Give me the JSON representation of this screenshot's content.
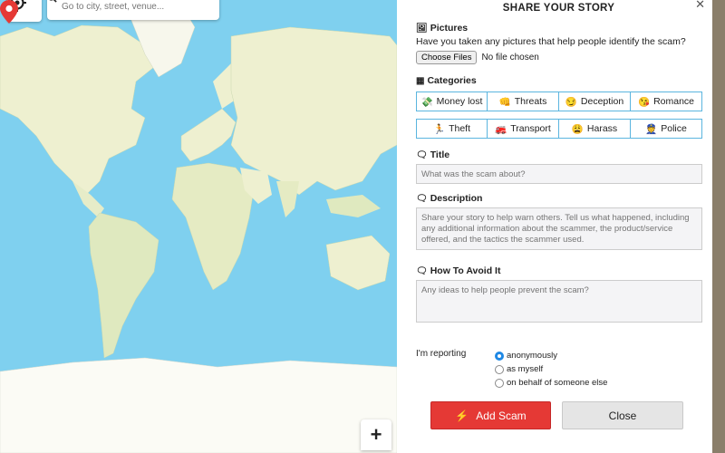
{
  "map": {
    "search_placeholder": "Go to city, street, venue...",
    "zoom_in_label": "+"
  },
  "panel": {
    "title": "SHARE YOUR STORY",
    "close_label": "✕",
    "pictures": {
      "heading": "Pictures",
      "question": "Have you taken any pictures that help people identify the scam?",
      "choose_files": "Choose Files",
      "no_file": "No file chosen"
    },
    "categories": {
      "heading": "Categories",
      "row1": [
        {
          "emoji": "💸",
          "label": "Money lost"
        },
        {
          "emoji": "👊",
          "label": "Threats"
        },
        {
          "emoji": "😏",
          "label": "Deception"
        },
        {
          "emoji": "😘",
          "label": "Romance"
        }
      ],
      "row2": [
        {
          "emoji": "🏃",
          "label": "Theft"
        },
        {
          "emoji": "🚒",
          "label": "Transport"
        },
        {
          "emoji": "😩",
          "label": "Harass"
        },
        {
          "emoji": "👮",
          "label": "Police"
        }
      ]
    },
    "title_field": {
      "heading": "Title",
      "placeholder": "What was the scam about?"
    },
    "description_field": {
      "heading": "Description",
      "placeholder": "Share your story to help warn others. Tell us what happened, including any additional information about the scammer, the product/service offered, and the tactics the scammer used."
    },
    "avoid_field": {
      "heading": "How To Avoid It",
      "placeholder": "Any ideas to help people prevent the scam?"
    },
    "reporting": {
      "label": "I'm reporting",
      "options": [
        "anonymously",
        "as myself",
        "on behalf of someone else"
      ],
      "selected": "anonymously"
    },
    "add_button": "Add Scam",
    "close_button": "Close"
  },
  "colors": {
    "water": "#7fd0ef",
    "land": "#f2f3d6",
    "accent_red": "#e53935",
    "category_border": "#5bb5df"
  }
}
